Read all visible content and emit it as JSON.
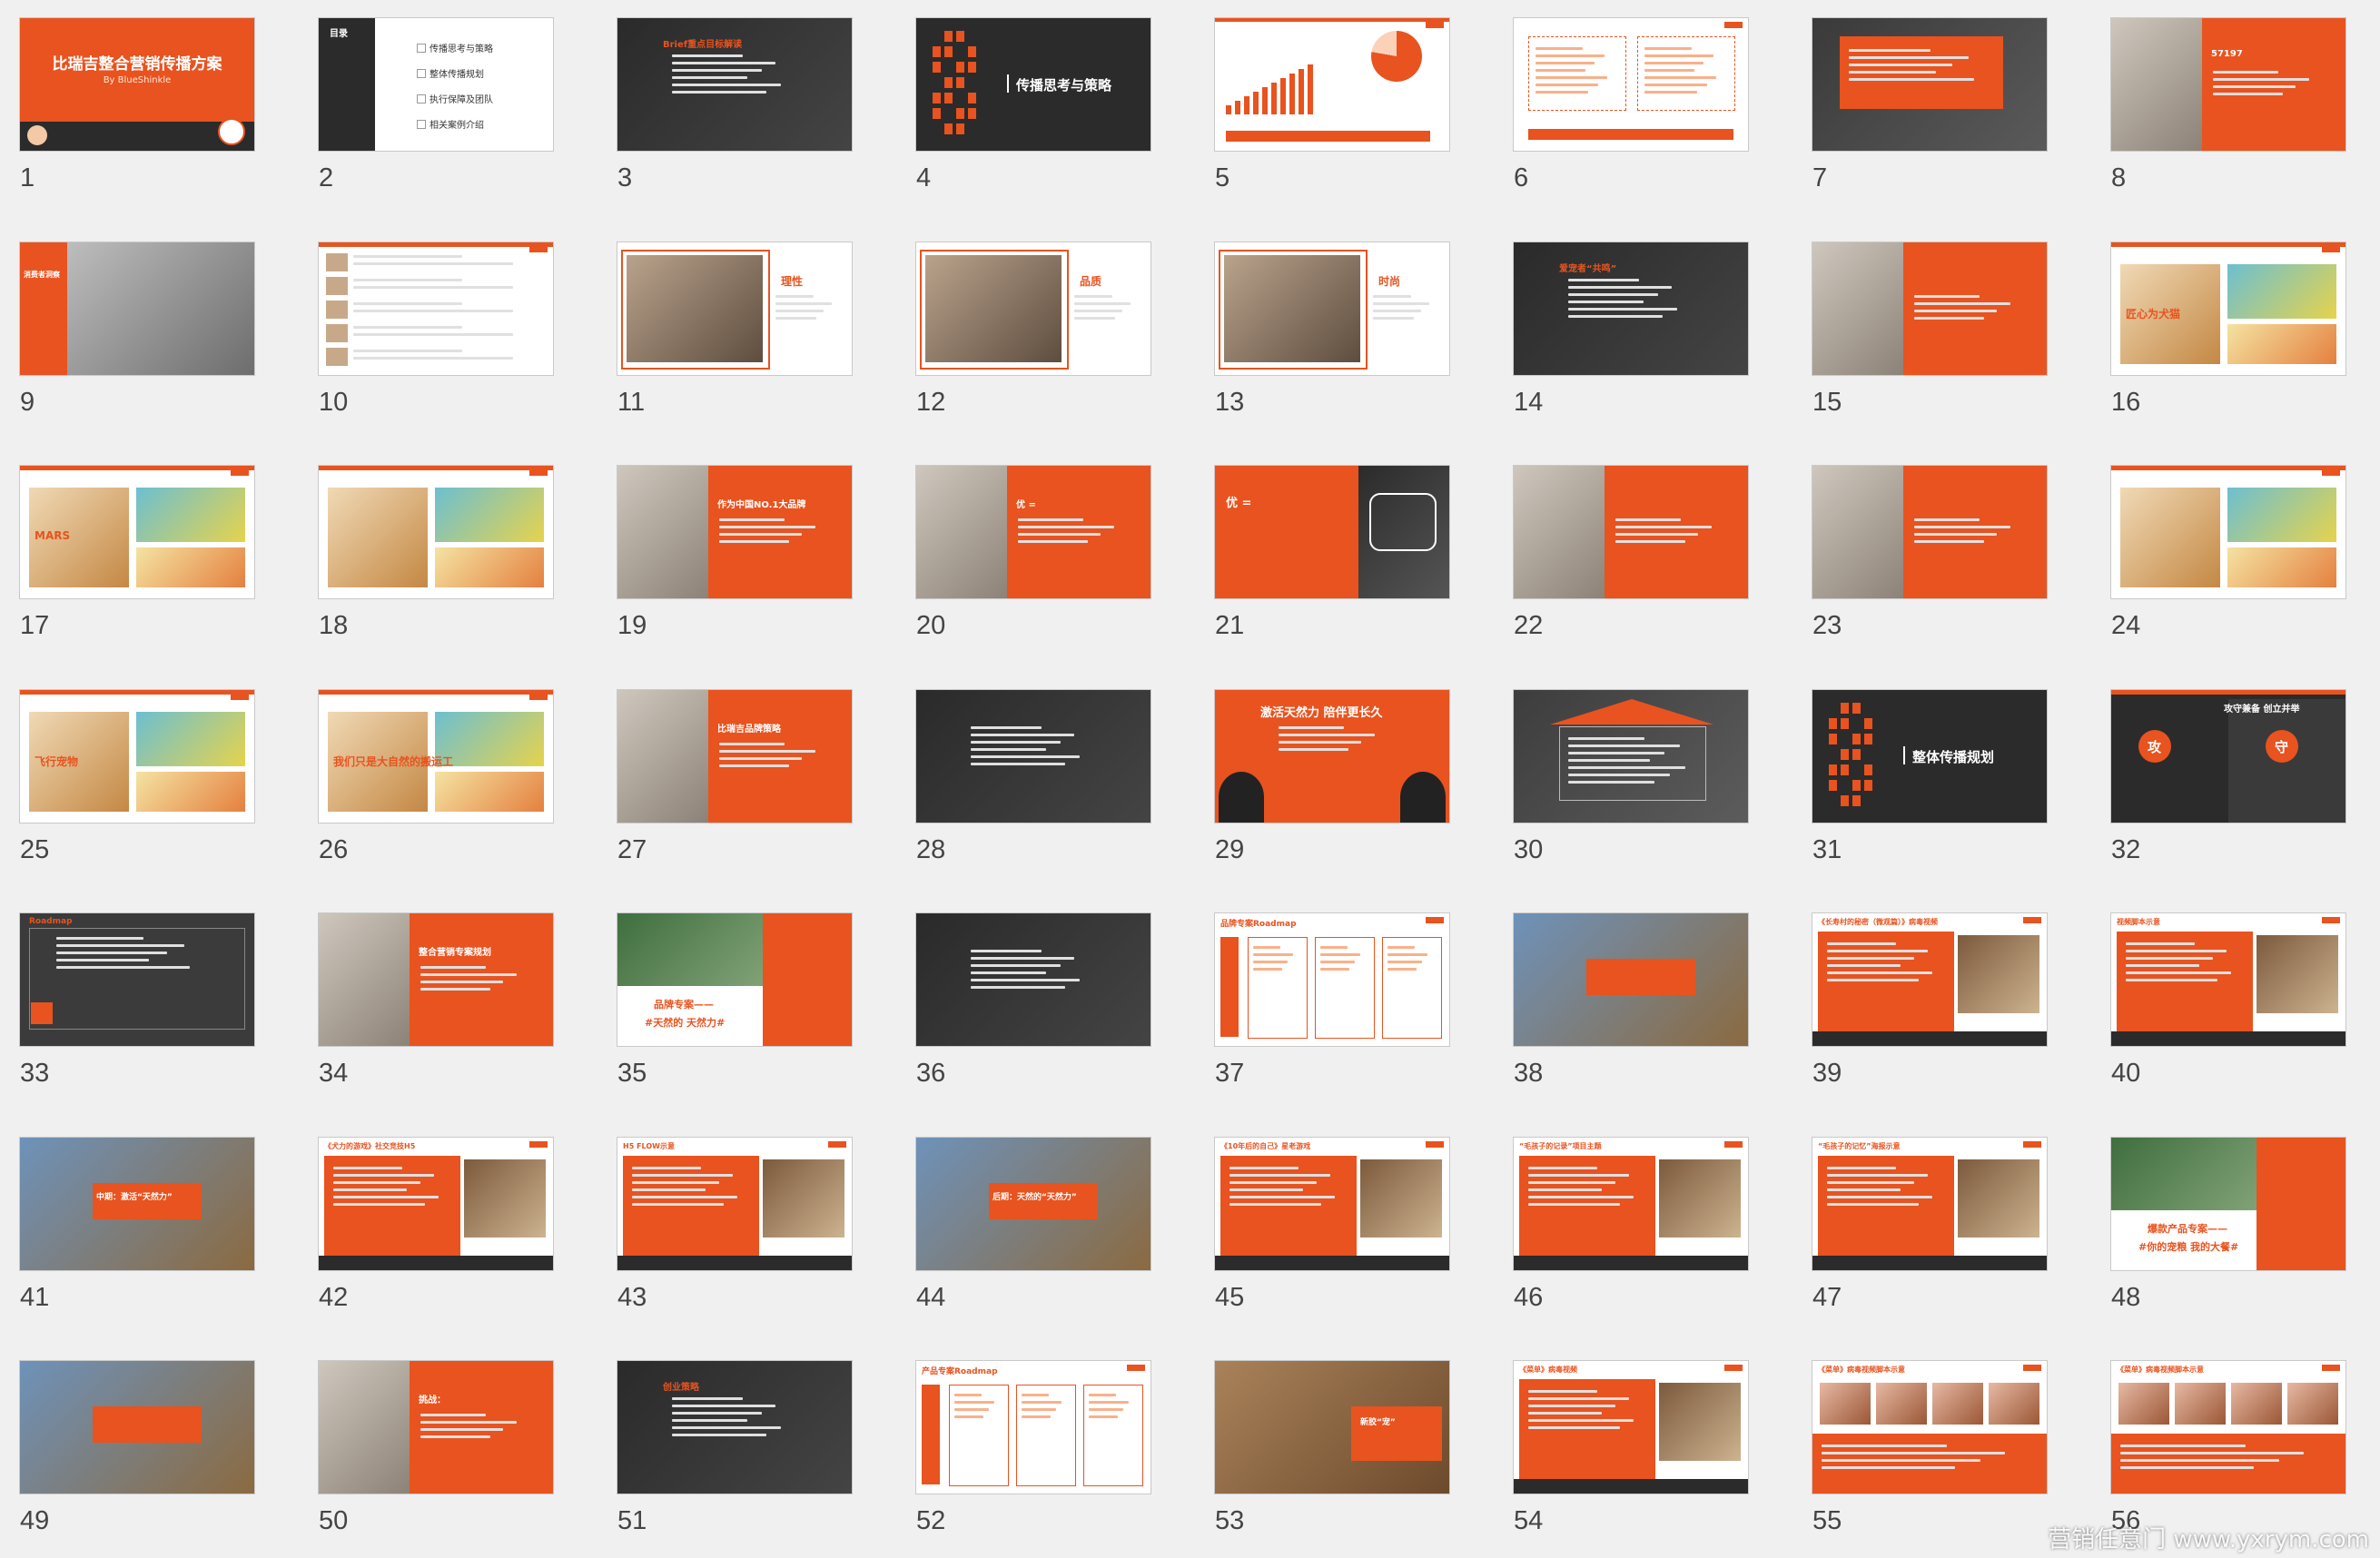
{
  "colors": {
    "accent": "#e8531f",
    "dark": "#2b2b2b",
    "background": "#f0f0f0"
  },
  "watermark": "营销任意门 www.yxrym.com",
  "slides": [
    {
      "n": "1",
      "kind": "title",
      "title": "比瑞吉整合营销传播方案",
      "sub": "By BlueShinkle"
    },
    {
      "n": "2",
      "kind": "toc",
      "label": "目录",
      "items": [
        "传播思考与策略",
        "整体传播规划",
        "执行保障及团队",
        "相关案例介绍"
      ]
    },
    {
      "n": "3",
      "kind": "dark-photo",
      "label": "Brief重点目标解读"
    },
    {
      "n": "4",
      "kind": "section",
      "label": "传播思考与策略"
    },
    {
      "n": "5",
      "kind": "chart"
    },
    {
      "n": "6",
      "kind": "text-boxes"
    },
    {
      "n": "7",
      "kind": "dark-orange"
    },
    {
      "n": "8",
      "kind": "photo-orange-right",
      "label": "57197"
    },
    {
      "n": "9",
      "kind": "photo-orange-left",
      "label": "消费者洞察"
    },
    {
      "n": "10",
      "kind": "text"
    },
    {
      "n": "11",
      "kind": "photo-text",
      "label": "理性"
    },
    {
      "n": "12",
      "kind": "photo-text",
      "label": "品质"
    },
    {
      "n": "13",
      "kind": "photo-text",
      "label": "时尚"
    },
    {
      "n": "14",
      "kind": "dark-photo",
      "label": "爱宠者“共鸣”"
    },
    {
      "n": "15",
      "kind": "photo-orange-right"
    },
    {
      "n": "16",
      "kind": "collage",
      "label": "匠心为犬猫"
    },
    {
      "n": "17",
      "kind": "collage",
      "label": "MARS"
    },
    {
      "n": "18",
      "kind": "collage"
    },
    {
      "n": "19",
      "kind": "photo-orange-right",
      "label": "作为中国NO.1大品牌"
    },
    {
      "n": "20",
      "kind": "photo-orange-right",
      "label": "优 ="
    },
    {
      "n": "21",
      "kind": "orange-dark",
      "label": "优 ="
    },
    {
      "n": "22",
      "kind": "photo-orange-right"
    },
    {
      "n": "23",
      "kind": "photo-orange-right"
    },
    {
      "n": "24",
      "kind": "collage"
    },
    {
      "n": "25",
      "kind": "collage",
      "label": "飞行宠物"
    },
    {
      "n": "26",
      "kind": "collage",
      "label": "我们只是大自然的搬运工"
    },
    {
      "n": "27",
      "kind": "photo-orange-right",
      "label": "比瑞吉品牌策略"
    },
    {
      "n": "28",
      "kind": "dark-photo"
    },
    {
      "n": "29",
      "kind": "orange-dogs",
      "label": "激活天然力 陪伴更长久"
    },
    {
      "n": "30",
      "kind": "house-chart"
    },
    {
      "n": "31",
      "kind": "section",
      "label": "整体传播规划"
    },
    {
      "n": "32",
      "kind": "attack-defend",
      "label": "攻守兼备 创立并举",
      "a": "攻",
      "d": "守"
    },
    {
      "n": "33",
      "kind": "dark-road",
      "label": "Roadmap"
    },
    {
      "n": "34",
      "kind": "photo-orange-right",
      "label": "整合营销专案规划"
    },
    {
      "n": "35",
      "kind": "photo-orange-band",
      "label": "品牌专案——",
      "sub": "#天然的 天然力#"
    },
    {
      "n": "36",
      "kind": "dark-photo"
    },
    {
      "n": "37",
      "kind": "roadmap",
      "label": "品牌专案Roadmap"
    },
    {
      "n": "38",
      "kind": "landscape"
    },
    {
      "n": "39",
      "kind": "orange-media",
      "label": "《长寿村的秘密（微观篇）》病毒视频"
    },
    {
      "n": "40",
      "kind": "orange-media",
      "label": "视频脚本示意"
    },
    {
      "n": "41",
      "kind": "landscape",
      "label": "中期：激活“天然力”"
    },
    {
      "n": "42",
      "kind": "orange-media",
      "label": "《犬力的游戏》社交竞技H5"
    },
    {
      "n": "43",
      "kind": "orange-media",
      "label": "H5 FLOW示意"
    },
    {
      "n": "44",
      "kind": "landscape",
      "label": "后期：天然的“天然力”"
    },
    {
      "n": "45",
      "kind": "orange-media",
      "label": "《10年后的自己》星老游戏"
    },
    {
      "n": "46",
      "kind": "orange-media",
      "label": "“毛孩子的记录”项目主题"
    },
    {
      "n": "47",
      "kind": "orange-media",
      "label": "“毛孩子的记忆”海报示意"
    },
    {
      "n": "48",
      "kind": "photo-orange-band",
      "label": "爆款产品专案——",
      "sub": "#你的宠粮 我的大餐#"
    },
    {
      "n": "49",
      "kind": "landscape"
    },
    {
      "n": "50",
      "kind": "photo-orange-right",
      "label": "挑战："
    },
    {
      "n": "51",
      "kind": "dark-photo",
      "label": "创业策略"
    },
    {
      "n": "52",
      "kind": "roadmap",
      "label": "产品专案Roadmap"
    },
    {
      "n": "53",
      "kind": "spoons",
      "label": "新胶“宠”"
    },
    {
      "n": "54",
      "kind": "orange-media",
      "label": "《菜单》病毒视频"
    },
    {
      "n": "55",
      "kind": "food-strip",
      "label": "《菜单》病毒视频脚本示意"
    },
    {
      "n": "56",
      "kind": "food-strip",
      "label": "《菜单》病毒视频脚本示意"
    }
  ]
}
